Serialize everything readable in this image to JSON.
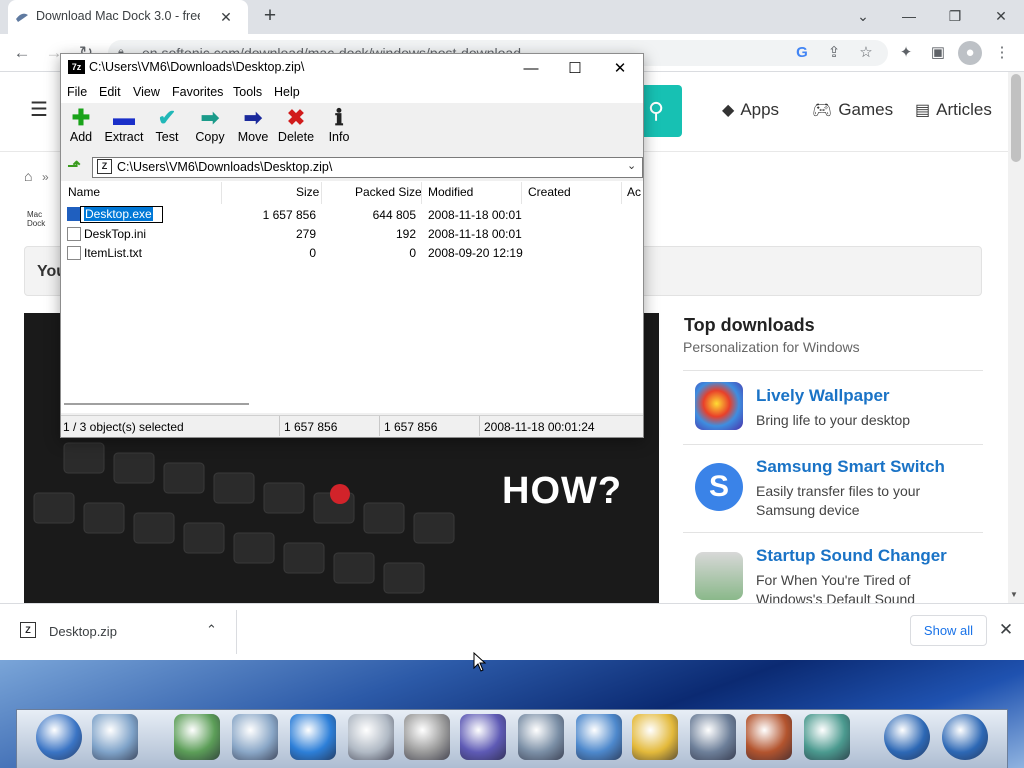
{
  "browser": {
    "tab_title": "Download Mac Dock 3.0 - free - ",
    "tab_close": "✕",
    "new_tab": "+",
    "url": "en.softonic.com/download/mac-dock/windows/post-download",
    "window_controls": {
      "minimize": "⌄",
      "min": "—",
      "restore": "❐",
      "close": "✕"
    },
    "toolbar_icons": [
      "google-icon",
      "share-icon",
      "star-icon",
      "extensions-icon",
      "sidebar-icon",
      "profile-icon",
      "menu-icon"
    ]
  },
  "site": {
    "nav": {
      "apps": "Apps",
      "games": "Games",
      "articles": "Articles"
    },
    "breadcrumb_sep": "»",
    "app_logo_text": "Mac\nDock",
    "notice_text": "You",
    "hero_text": "HOW?",
    "top_downloads": {
      "title": "Top downloads",
      "subtitle": "Personalization for Windows",
      "items": [
        {
          "name": "Lively Wallpaper",
          "desc": "Bring life to your desktop"
        },
        {
          "name": "Samsung Smart Switch",
          "desc": "Easily transfer files to your Samsung device"
        },
        {
          "name": "Startup Sound Changer",
          "desc": "For When You're Tired of Windows's Default Sound"
        }
      ]
    }
  },
  "sevenzip": {
    "app_icon": "7z",
    "title": "C:\\Users\\VM6\\Downloads\\Desktop.zip\\",
    "menu": [
      "File",
      "Edit",
      "View",
      "Favorites",
      "Tools",
      "Help"
    ],
    "tools": [
      {
        "label": "Add",
        "glyph": "✚",
        "color": "#1aa31a"
      },
      {
        "label": "Extract",
        "glyph": "▬",
        "color": "#1a2fc9"
      },
      {
        "label": "Test",
        "glyph": "✔",
        "color": "#21b8b8"
      },
      {
        "label": "Copy",
        "glyph": "➡",
        "color": "#1b9b8a"
      },
      {
        "label": "Move",
        "glyph": "➡",
        "color": "#1b2a9c"
      },
      {
        "label": "Delete",
        "glyph": "✖",
        "color": "#d11b1b"
      },
      {
        "label": "Info",
        "glyph": "ℹ",
        "color": "#222222"
      }
    ],
    "path": "C:\\Users\\VM6\\Downloads\\Desktop.zip\\",
    "columns": [
      "Name",
      "Size",
      "Packed Size",
      "Modified",
      "Created",
      "Ac"
    ],
    "files": [
      {
        "name": "Desktop.exe",
        "size": "1 657 856",
        "packed": "644 805",
        "modified": "2008-11-18 00:01",
        "created": ""
      },
      {
        "name": "DeskTop.ini",
        "size": "279",
        "packed": "192",
        "modified": "2008-11-18 00:01",
        "created": ""
      },
      {
        "name": "ItemList.txt",
        "size": "0",
        "packed": "0",
        "modified": "2008-09-20 12:19",
        "created": ""
      }
    ],
    "status": {
      "selected": "1 / 3 object(s) selected",
      "size": "1 657 856",
      "packed": "1 657 856",
      "date": "2008-11-18 00:01:24"
    }
  },
  "download_bar": {
    "file_name": "Desktop.zip",
    "show_all": "Show all",
    "close": "✕"
  },
  "dock": {
    "icons": [
      {
        "name": "keychain-icon",
        "color": "#3a74c4"
      },
      {
        "name": "trash-icon",
        "color": "#7fa3c9"
      },
      {
        "name": "network-computer-icon",
        "color": "#5c9e58"
      },
      {
        "name": "mail-icon",
        "color": "#8aa7c7"
      },
      {
        "name": "internet-explorer-icon",
        "color": "#2d7fd8"
      },
      {
        "name": "search-magnifier-icon",
        "color": "#b0b9c4"
      },
      {
        "name": "text-document-icon",
        "color": "#9a9a9a"
      },
      {
        "name": "cube-app-icon",
        "color": "#5e5ab5"
      },
      {
        "name": "hard-drive-icon",
        "color": "#7b8fa6"
      },
      {
        "name": "clock-folder-icon",
        "color": "#4d88cc"
      },
      {
        "name": "settings-hexagon-icon",
        "color": "#e3b93a"
      },
      {
        "name": "music-player-icon",
        "color": "#6d7f99"
      },
      {
        "name": "media-player-icon",
        "color": "#b3542e"
      },
      {
        "name": "paint-icon",
        "color": "#4b9a8f"
      },
      {
        "name": "restart-icon",
        "color": "#2d68b5"
      },
      {
        "name": "power-icon",
        "color": "#2d68b5"
      }
    ]
  }
}
